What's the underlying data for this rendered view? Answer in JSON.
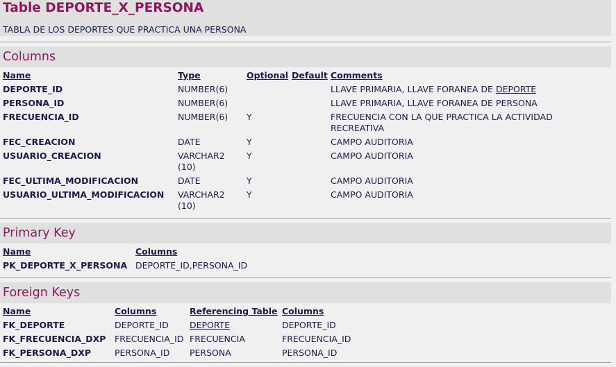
{
  "page": {
    "title": "Table DEPORTE_X_PERSONA",
    "description": "TABLA DE LOS DEPORTES QUE PRACTICA UNA PERSONA"
  },
  "columns_section": {
    "title": "Columns",
    "headers": {
      "name": "Name",
      "type": "Type",
      "optional": "Optional",
      "default": "Default",
      "comments": "Comments"
    },
    "rows": [
      {
        "name": "DEPORTE_ID",
        "type": "NUMBER(6)",
        "optional": "",
        "default": "",
        "comment": "LLAVE PRIMARIA, LLAVE FORANEA DE",
        "comment_link": "DEPORTE"
      },
      {
        "name": "PERSONA_ID",
        "type": "NUMBER(6)",
        "optional": "",
        "default": "",
        "comment": "LLAVE PRIMARIA, LLAVE FORANEA DE PERSONA"
      },
      {
        "name": "FRECUENCIA_ID",
        "type": "NUMBER(6)",
        "optional": "Y",
        "default": "",
        "comment": "FRECUENCIA CON LA QUE PRACTICA LA ACTIVIDAD",
        "comment_line2": "RECREATIVA"
      },
      {
        "name": "FEC_CREACION",
        "type": "DATE",
        "optional": "Y",
        "default": "",
        "comment": "CAMPO AUDITORIA"
      },
      {
        "name": "USUARIO_CREACION",
        "type": "VARCHAR2",
        "type_line2": "(10)",
        "optional": "Y",
        "default": "",
        "comment": "CAMPO AUDITORIA"
      },
      {
        "name": "FEC_ULTIMA_MODIFICACION",
        "type": "DATE",
        "optional": "Y",
        "default": "",
        "comment": "CAMPO AUDITORIA"
      },
      {
        "name": "USUARIO_ULTIMA_MODIFICACION",
        "type": "VARCHAR2",
        "type_line2": "(10)",
        "optional": "Y",
        "default": "",
        "comment": "CAMPO AUDITORIA"
      }
    ]
  },
  "primary_key_section": {
    "title": "Primary Key",
    "headers": {
      "name": "Name",
      "columns": "Columns"
    },
    "rows": [
      {
        "name": "PK_DEPORTE_X_PERSONA",
        "columns": "DEPORTE_ID,PERSONA_ID"
      }
    ]
  },
  "foreign_keys_section": {
    "title": "Foreign Keys",
    "headers": {
      "name": "Name",
      "columns": "Columns",
      "referencing_table": "Referencing Table",
      "ref_columns": "Columns"
    },
    "rows": [
      {
        "name": "FK_DEPORTE",
        "columns": "DEPORTE_ID",
        "referencing_table": "DEPORTE",
        "ref_columns": "DEPORTE_ID"
      },
      {
        "name": "FK_FRECUENCIA_DXP",
        "columns": "FRECUENCIA_ID",
        "referencing_table": "FRECUENCIA",
        "ref_columns": "FRECUENCIA_ID"
      },
      {
        "name": "FK_PERSONA_DXP",
        "columns": "PERSONA_ID",
        "referencing_table": "PERSONA",
        "ref_columns": "PERSONA_ID"
      }
    ]
  }
}
